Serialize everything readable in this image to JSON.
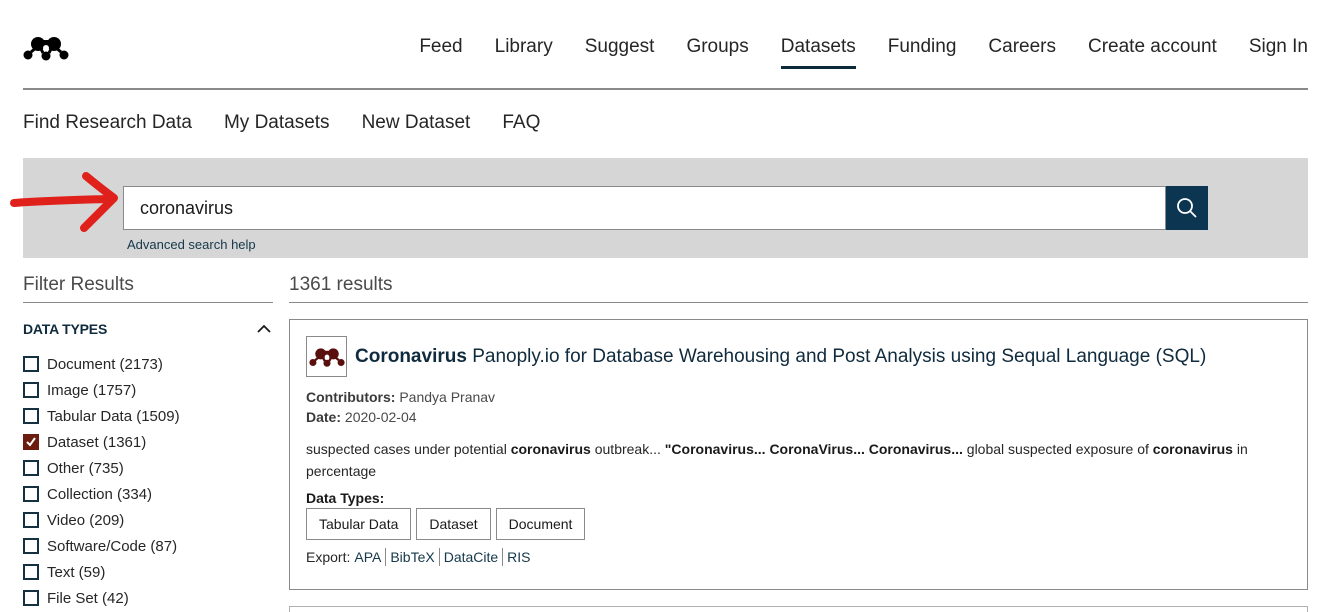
{
  "header": {
    "logo": "mendeley-logo-icon",
    "nav": [
      {
        "label": "Feed",
        "active": false
      },
      {
        "label": "Library",
        "active": false
      },
      {
        "label": "Suggest",
        "active": false
      },
      {
        "label": "Groups",
        "active": false
      },
      {
        "label": "Datasets",
        "active": true
      },
      {
        "label": "Funding",
        "active": false
      },
      {
        "label": "Careers",
        "active": false
      },
      {
        "label": "Create account",
        "active": false
      },
      {
        "label": "Sign In",
        "active": false
      }
    ]
  },
  "subnav": [
    {
      "label": "Find Research Data"
    },
    {
      "label": "My Datasets"
    },
    {
      "label": "New Dataset"
    },
    {
      "label": "FAQ"
    }
  ],
  "search": {
    "value": "coronavirus",
    "button_icon": "search-icon",
    "advanced_help": "Advanced search help"
  },
  "sidebar": {
    "title": "Filter Results",
    "section_title": "DATA TYPES",
    "items": [
      {
        "label": "Document (2173)",
        "checked": false
      },
      {
        "label": "Image (1757)",
        "checked": false
      },
      {
        "label": "Tabular Data (1509)",
        "checked": false
      },
      {
        "label": "Dataset (1361)",
        "checked": true
      },
      {
        "label": "Other (735)",
        "checked": false
      },
      {
        "label": "Collection (334)",
        "checked": false
      },
      {
        "label": "Video (209)",
        "checked": false
      },
      {
        "label": "Software/Code (87)",
        "checked": false
      },
      {
        "label": "Text (59)",
        "checked": false
      },
      {
        "label": "File Set (42)",
        "checked": false
      }
    ]
  },
  "results": {
    "count": "1361 results",
    "items": [
      {
        "title_bold": "Coronavirus",
        "title_rest": " Panoply.io for Database Warehousing and Post Analysis using Sequal Language (SQL)",
        "contributors_label": "Contributors:",
        "contributors": "Pandya Pranav",
        "date_label": "Date:",
        "date": "2020-02-04",
        "snippet": [
          {
            "t": "suspected cases under potential ",
            "b": false
          },
          {
            "t": "coronavirus",
            "b": true
          },
          {
            "t": " outbreak... ",
            "b": false
          },
          {
            "t": "\"Coronavirus... CoronaVirus... Coronavirus...",
            "b": true
          },
          {
            "t": " global suspected exposure of ",
            "b": false
          },
          {
            "t": "coronavirus",
            "b": true
          },
          {
            "t": " in percentage",
            "b": false
          }
        ],
        "data_types_label": "Data Types:",
        "data_types": [
          "Tabular Data",
          "Dataset",
          "Document"
        ],
        "export_label": "Export:",
        "export_links": [
          "APA",
          "BibTeX",
          "DataCite",
          "RIS"
        ]
      }
    ]
  },
  "colors": {
    "primary_dark": "#0b3550",
    "checked": "#6b1e0f",
    "search_band": "#d6d6d6",
    "annotation_red": "#e0201b"
  }
}
